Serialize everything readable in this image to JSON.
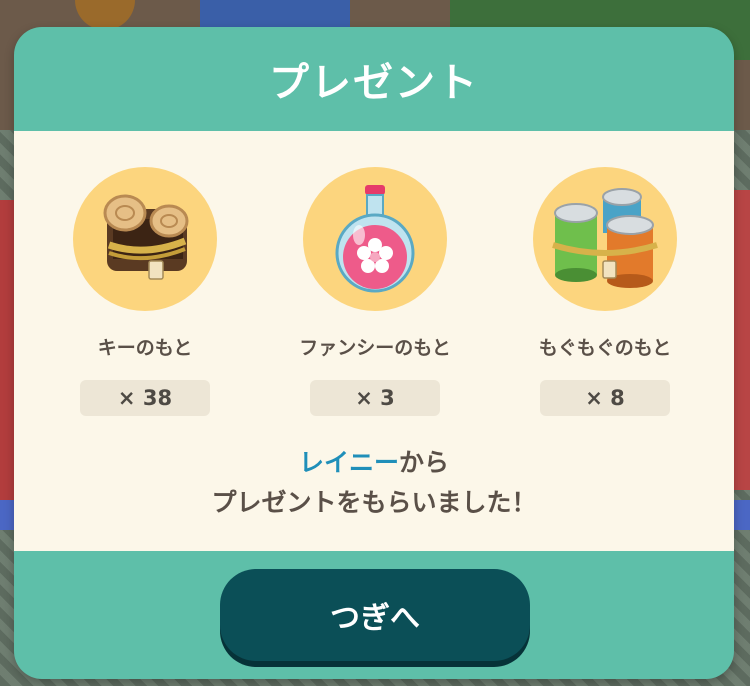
{
  "dialog": {
    "title": "プレゼント",
    "items": [
      {
        "name": "キーのもと",
        "count": "× 38",
        "icon": "wood-logs-icon"
      },
      {
        "name": "ファンシーのもと",
        "count": "× 3",
        "icon": "pink-potion-icon"
      },
      {
        "name": "もぐもぐのもと",
        "count": "× 8",
        "icon": "canned-food-icon"
      }
    ],
    "message": {
      "sender": "レイニー",
      "line1_suffix": "から",
      "line2": "プレゼントをもらいました！"
    },
    "next_label": "つぎへ"
  },
  "colors": {
    "frame": "#5ebfa9",
    "content_bg": "#fcf7e9",
    "item_circle": "#fcd57e",
    "sender_text": "#1f8fb9",
    "button": "#0b4f57"
  }
}
